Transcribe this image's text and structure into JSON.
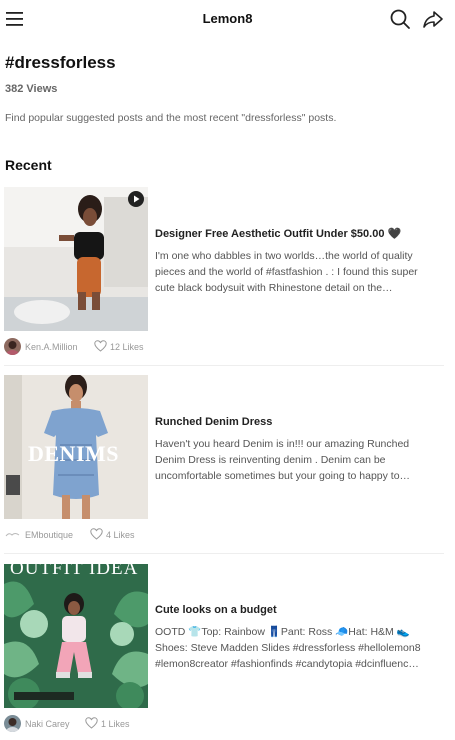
{
  "header": {
    "title": "Lemon8",
    "icons": [
      "menu-icon",
      "search-icon",
      "share-icon"
    ]
  },
  "hashtag": {
    "title": "#dressforless",
    "views": "382 Views",
    "description": "Find popular suggested posts and the most recent \"dressforless\" posts."
  },
  "section": {
    "title": "Recent"
  },
  "posts": [
    {
      "title": "Designer Free Aesthetic Outfit Under $50.00 🖤",
      "lines": [
        "I'm one who dabbles in two worlds…the world of quality",
        "pieces and the world of #fastfashion . : I found this super",
        "cute black bodysuit with Rhinestone detail on the…"
      ],
      "author": "Ken.A.Million",
      "likes": "12 Likes",
      "has_video": true
    },
    {
      "title": "Runched Denim Dress",
      "lines": [
        "Haven't you heard Denim is in!!! our amazing Runched",
        "Denim Dress is reinventing denim . Denim can be",
        "uncomfortable sometimes but your going to happy to…"
      ],
      "author": "EMboutique",
      "likes": "4 Likes",
      "overlay_text": "DENIMS"
    },
    {
      "title": "Cute looks on a budget",
      "lines": [
        "OOTD 👕Top: Rainbow 👖Pant: Ross 🧢Hat: H&M 👟",
        "Shoes: Steve Madden Slides #dressforless #hellolemon8",
        "#lemon8creator #fashionfinds #candytopia #dcinfluenc…"
      ],
      "author": "Naki Carey",
      "likes": "1 Likes",
      "overlay_text": "OUTFIT IDEA"
    }
  ]
}
